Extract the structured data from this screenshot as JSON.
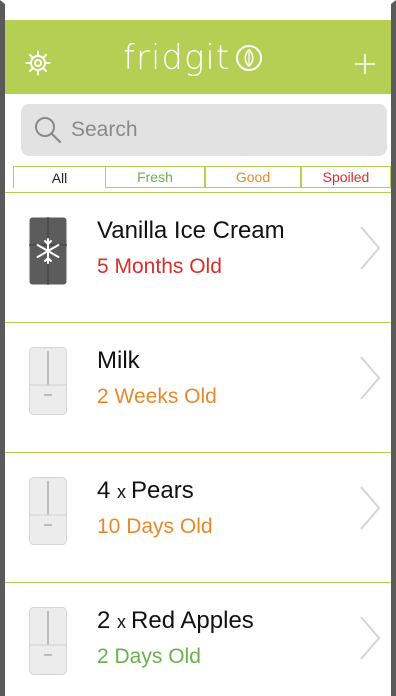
{
  "header": {
    "app_name": "fridgit",
    "icons": {
      "settings": "gear-icon",
      "logo": "leaf-circle-icon",
      "add": "plus-icon"
    },
    "colors": {
      "bar": "#b5cf54",
      "text": "#ffffff"
    }
  },
  "search": {
    "placeholder": "Search"
  },
  "filters": [
    {
      "label": "All",
      "selected": true
    },
    {
      "label": "Fresh",
      "color": "#6ab04c"
    },
    {
      "label": "Good",
      "color": "#e8892b"
    },
    {
      "label": "Spoiled",
      "color": "#d7302a"
    }
  ],
  "items": [
    {
      "quantity": "",
      "name": "Vanilla Ice Cream",
      "age": "5 Months Old",
      "status": "spoiled",
      "icon": "freezer-icon"
    },
    {
      "quantity": "",
      "name": "Milk",
      "age": "2 Weeks Old",
      "status": "good",
      "icon": "fridge-icon"
    },
    {
      "quantity": "4",
      "name": "Pears",
      "age": "10 Days Old",
      "status": "good",
      "icon": "fridge-icon"
    },
    {
      "quantity": "2",
      "name": "Red Apples",
      "age": "2 Days Old",
      "status": "fresh",
      "icon": "fridge-icon"
    }
  ]
}
